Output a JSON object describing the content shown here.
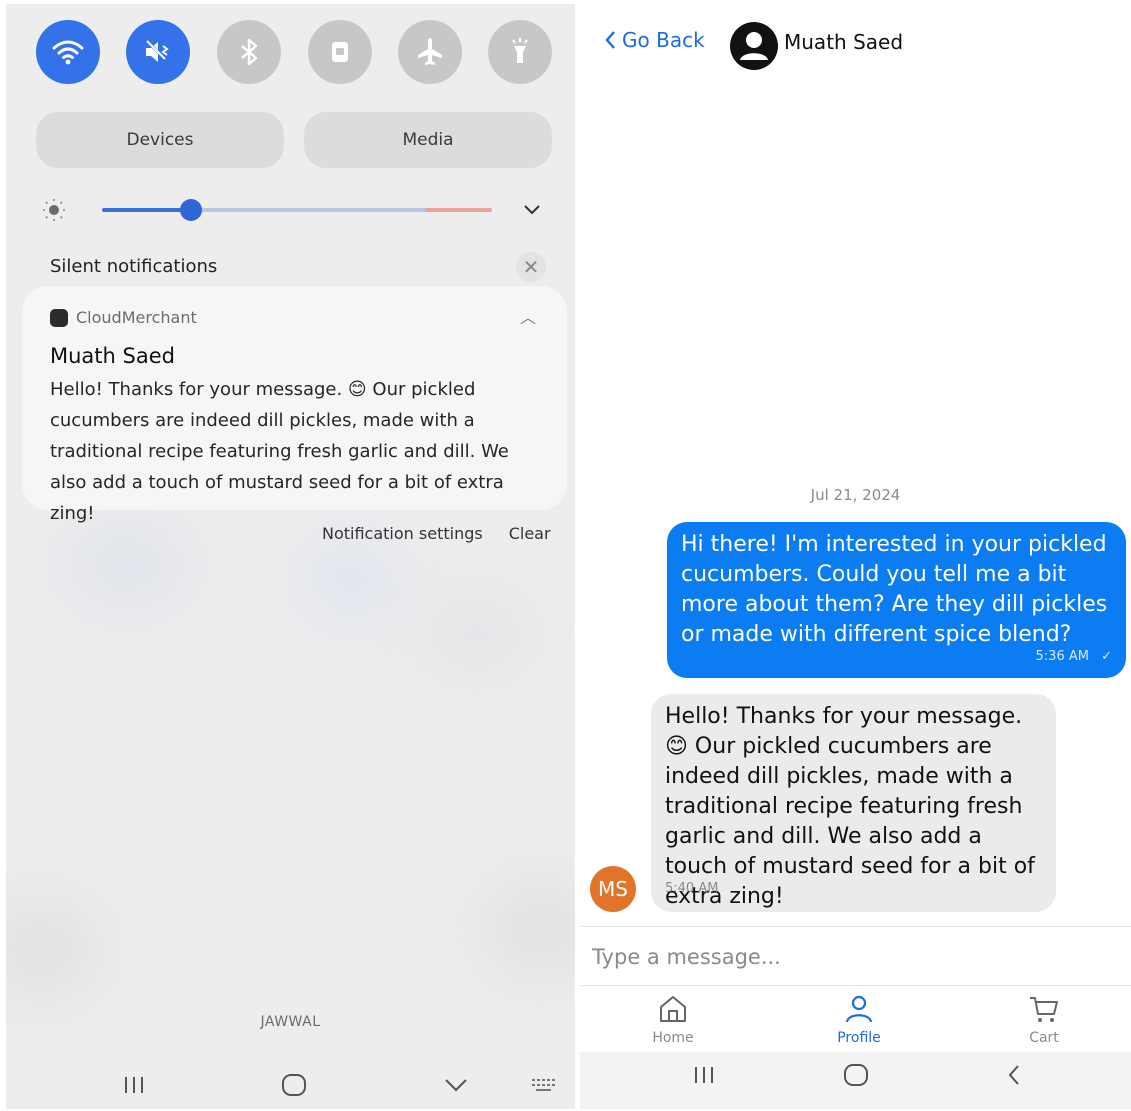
{
  "notification_shade": {
    "quick_settings": [
      {
        "icon": "wifi-icon",
        "state": "on"
      },
      {
        "icon": "sound-off-icon",
        "state": "on"
      },
      {
        "icon": "bluetooth-icon",
        "state": "off"
      },
      {
        "icon": "lock-icon",
        "state": "off"
      },
      {
        "icon": "airplane-icon",
        "state": "off"
      },
      {
        "icon": "flashlight-icon",
        "state": "off"
      }
    ],
    "devices_label": "Devices",
    "media_label": "Media",
    "brightness_level": 0.23,
    "silent_title": "Silent notifications",
    "notification": {
      "app": "CloudMerchant",
      "sender": "Muath Saed",
      "body": "Hello! Thanks for your message. 😊 Our pickled cucumbers are indeed dill pickles, made with a traditional recipe featuring fresh garlic and dill. We also add a touch of mustard seed for a bit of extra zing!"
    },
    "settings_label": "Notification settings",
    "clear_label": "Clear",
    "carrier": "JAWWAL"
  },
  "chat": {
    "back_label": "Go Back",
    "peer_name": "Muath Saed",
    "date": "Jul 21, 2024",
    "messages": [
      {
        "direction": "out",
        "text": "Hi there! I'm interested in your pickled cucumbers. Could you tell me a bit more about them? Are they dill pickles or made with different spice blend?",
        "time": "5:36 AM",
        "status": "✓"
      },
      {
        "direction": "in",
        "text": "Hello! Thanks for your message. 😊 Our pickled cucumbers are indeed dill pickles, made with a traditional recipe featuring fresh garlic and dill. We also add a touch of mustard seed for a bit of extra zing!",
        "time": "5:40 AM",
        "avatar_initials": "MS"
      }
    ],
    "input_placeholder": "Type a message...",
    "tabs": [
      {
        "label": "Home",
        "icon": "home-icon",
        "active": false
      },
      {
        "label": "Profile",
        "icon": "profile-icon",
        "active": true
      },
      {
        "label": "Cart",
        "icon": "cart-icon",
        "active": false
      }
    ]
  },
  "colors": {
    "accent": "#0b7cf2",
    "qs_active": "#3372e8",
    "avatar_ms": "#e0742b"
  }
}
